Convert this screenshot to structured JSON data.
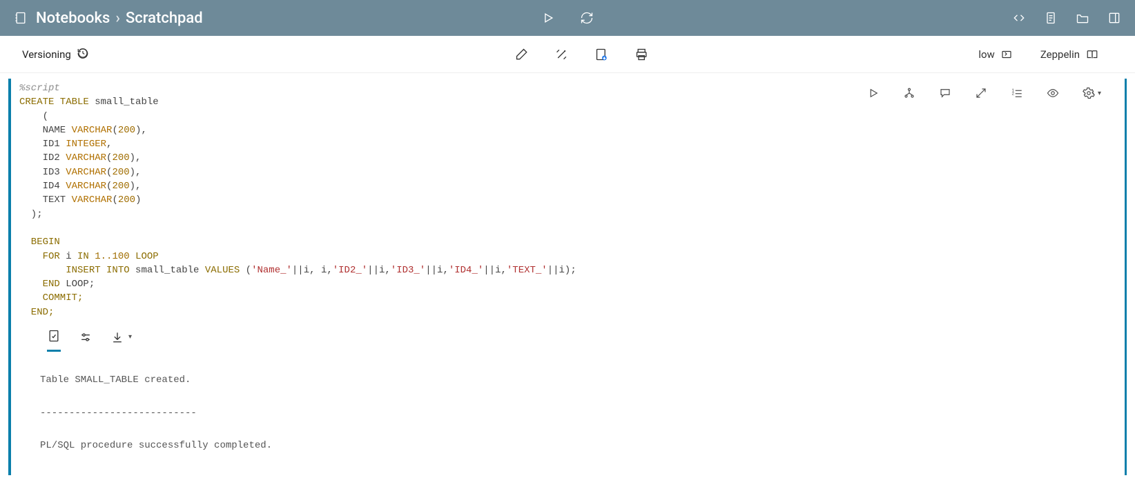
{
  "topbar": {
    "breadcrumb_root": "Notebooks",
    "breadcrumb_current": "Scratchpad"
  },
  "secondbar": {
    "versioning_label": "Versioning",
    "low_label": "low",
    "zeppelin_label": "Zeppelin"
  },
  "code": {
    "directive": "%script",
    "l1a": "CREATE TABLE",
    "l1b": " small_table",
    "l2": "    (",
    "l3a": "    NAME ",
    "l3b": "VARCHAR",
    "l3c": "(",
    "l3d": "200",
    "l3e": "),",
    "l4a": "    ID1 ",
    "l4b": "INTEGER",
    "l4c": ",",
    "l5a": "    ID2 ",
    "l6a": "    ID3 ",
    "l7a": "    ID4 ",
    "l8a": "    TEXT ",
    "l8e": ")",
    "l9": "  );",
    "blank": " ",
    "l10": "  BEGIN",
    "l11a": "    FOR",
    "l11b": " i ",
    "l11c": "IN",
    "l11d": " 1..100 ",
    "l11e": "LOOP",
    "l12a": "        INSERT INTO",
    "l12b": " small_table ",
    "l12c": "VALUES",
    "l12d": " (",
    "s1": "'Name_'",
    "pp": "||",
    "iv": "i",
    "cm": ", ",
    "s2": "'ID2_'",
    "s3": "'ID3_'",
    "s4": "'ID4_'",
    "s5": "'TEXT_'",
    "l12end": ");",
    "l13a": "    END",
    "l13b": " LOOP;",
    "l14": "    COMMIT;",
    "l15": "  END;"
  },
  "output": {
    "line1": "Table SMALL_TABLE created.",
    "sep": "---------------------------",
    "line2": "PL/SQL procedure successfully completed."
  }
}
